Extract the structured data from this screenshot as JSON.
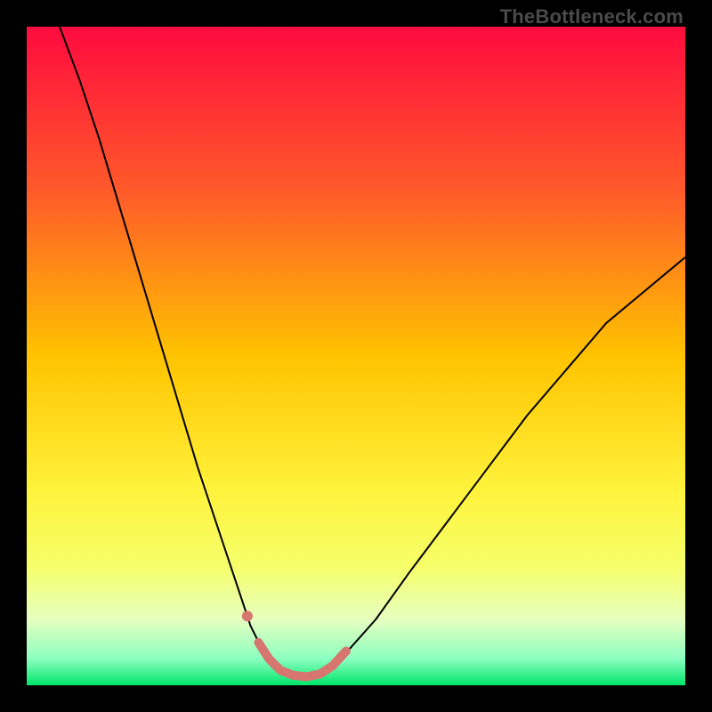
{
  "watermark": "TheBottleneck.com",
  "chart_data": {
    "type": "line",
    "title": "",
    "xlabel": "",
    "ylabel": "",
    "xlim": [
      0,
      100
    ],
    "ylim": [
      0,
      100
    ],
    "gradient_stops": [
      {
        "offset": 0.0,
        "color": "#ff0b3f"
      },
      {
        "offset": 0.25,
        "color": "#ff5a2a"
      },
      {
        "offset": 0.5,
        "color": "#ffc300"
      },
      {
        "offset": 0.7,
        "color": "#fff23a"
      },
      {
        "offset": 0.82,
        "color": "#f6ff6a"
      },
      {
        "offset": 0.9,
        "color": "#e6ffc0"
      },
      {
        "offset": 0.96,
        "color": "#8bffc0"
      },
      {
        "offset": 1.0,
        "color": "#00e56a"
      }
    ],
    "series": [
      {
        "name": "Bottleneck curve",
        "stroke": "#000000",
        "stroke_width": 2,
        "points": [
          {
            "x": 5,
            "y": 100
          },
          {
            "x": 8,
            "y": 92
          },
          {
            "x": 11,
            "y": 83
          },
          {
            "x": 14,
            "y": 73
          },
          {
            "x": 17,
            "y": 63
          },
          {
            "x": 20,
            "y": 53
          },
          {
            "x": 23,
            "y": 43
          },
          {
            "x": 26,
            "y": 33
          },
          {
            "x": 29,
            "y": 24
          },
          {
            "x": 32,
            "y": 15
          },
          {
            "x": 34,
            "y": 9
          },
          {
            "x": 36,
            "y": 5
          },
          {
            "x": 38,
            "y": 2.5
          },
          {
            "x": 40,
            "y": 1.5
          },
          {
            "x": 42,
            "y": 1.2
          },
          {
            "x": 44,
            "y": 1.5
          },
          {
            "x": 46,
            "y": 2.7
          },
          {
            "x": 49,
            "y": 5.5
          },
          {
            "x": 53,
            "y": 10
          },
          {
            "x": 58,
            "y": 17
          },
          {
            "x": 64,
            "y": 25
          },
          {
            "x": 70,
            "y": 33
          },
          {
            "x": 76,
            "y": 41
          },
          {
            "x": 82,
            "y": 48
          },
          {
            "x": 88,
            "y": 55
          },
          {
            "x": 94,
            "y": 60
          },
          {
            "x": 100,
            "y": 65
          }
        ]
      },
      {
        "name": "Highlight segment",
        "stroke": "#d7766f",
        "stroke_width": 10,
        "linecap": "round",
        "points": [
          {
            "x": 35.2,
            "y": 6.5
          },
          {
            "x": 36.8,
            "y": 4.0
          },
          {
            "x": 38.5,
            "y": 2.3
          },
          {
            "x": 40.5,
            "y": 1.5
          },
          {
            "x": 42.5,
            "y": 1.3
          },
          {
            "x": 44.5,
            "y": 1.7
          },
          {
            "x": 46.5,
            "y": 3.0
          },
          {
            "x": 48.5,
            "y": 5.2
          }
        ]
      }
    ],
    "markers": [
      {
        "name": "Highlight dot",
        "x": 33.5,
        "y": 10.5,
        "r": 6,
        "fill": "#d7766f"
      }
    ]
  }
}
